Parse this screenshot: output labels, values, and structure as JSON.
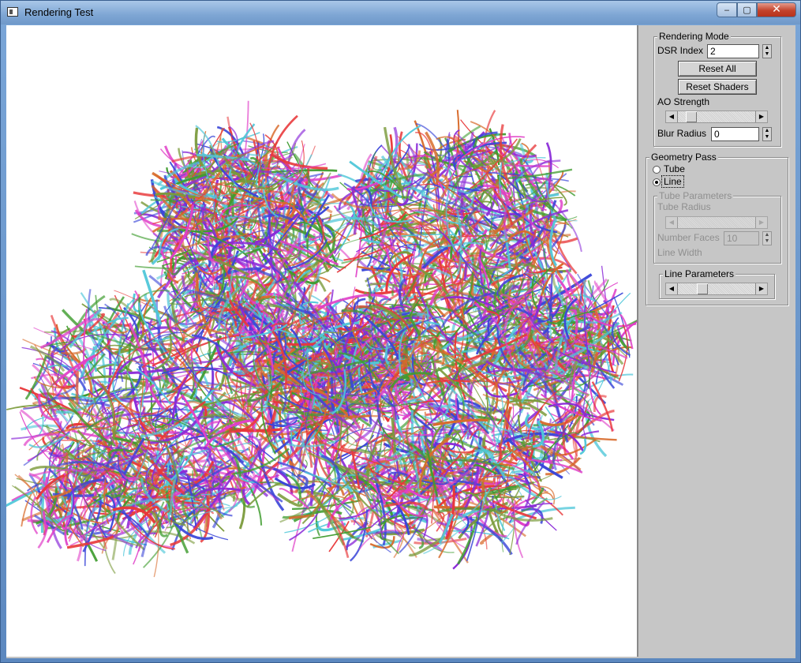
{
  "window": {
    "title": "Rendering Test"
  },
  "rendering_mode": {
    "legend": "Rendering Mode",
    "dsr_label": "DSR Index",
    "dsr_value": "2",
    "reset_all": "Reset All",
    "reset_shaders": "Reset Shaders",
    "ao_label": "AO Strength",
    "ao_level": 0.12,
    "blur_label": "Blur Radius",
    "blur_value": "0"
  },
  "geometry_pass": {
    "legend": "Geometry Pass",
    "tube_label": "Tube",
    "line_label": "Line",
    "selected": "Line",
    "tube_params": {
      "legend": "Tube Parameters",
      "radius_label": "Tube Radius",
      "faces_label": "Number Faces",
      "faces_value": "10",
      "line_width_label": "Line Width"
    },
    "line_params": {
      "legend": "Line Parameters",
      "level": 0.28
    }
  },
  "colors": {
    "fiber_red": "#e8383a",
    "fiber_green": "#3f9c2f",
    "fiber_blue": "#3a46d8",
    "fiber_magenta": "#e040c8",
    "fiber_cyan": "#4fc7d9"
  }
}
